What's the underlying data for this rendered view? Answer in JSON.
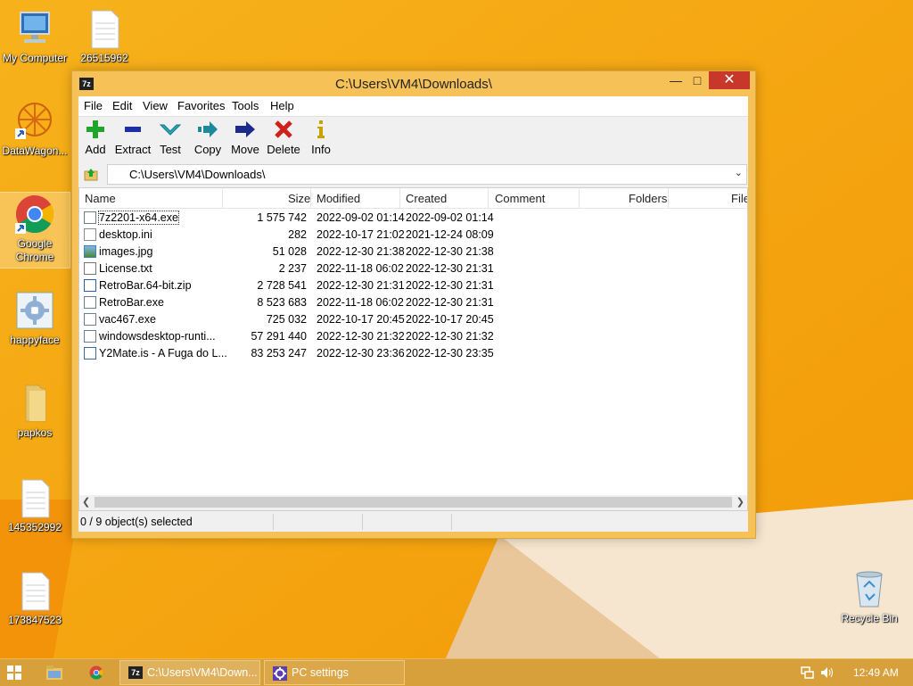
{
  "desktop": {
    "icons": [
      {
        "label": "My Computer"
      },
      {
        "label": "26515962"
      },
      {
        "label": "DataWagon..."
      },
      {
        "label": "Google Chrome"
      },
      {
        "label": "happyface"
      },
      {
        "label": "papkos"
      },
      {
        "label": "145352992"
      },
      {
        "label": "173847523"
      },
      {
        "label": "Recycle Bin"
      }
    ]
  },
  "window": {
    "title": "C:\\Users\\VM4\\Downloads\\",
    "app_icon_text": "7z",
    "menu": [
      "File",
      "Edit",
      "View",
      "Favorites",
      "Tools",
      "Help"
    ],
    "toolbar": [
      {
        "label": "Add",
        "icon": "plus-icon",
        "color": "#1fa52a"
      },
      {
        "label": "Extract",
        "icon": "minus-icon",
        "color": "#1c2fa5"
      },
      {
        "label": "Test",
        "icon": "check-icon",
        "color": "#2aa7b8"
      },
      {
        "label": "Copy",
        "icon": "copy-arrow-icon",
        "color": "#1c8a9c"
      },
      {
        "label": "Move",
        "icon": "move-arrow-icon",
        "color": "#1c2a8c"
      },
      {
        "label": "Delete",
        "icon": "x-icon",
        "color": "#d0201c"
      },
      {
        "label": "Info",
        "icon": "info-icon",
        "color": "#c9a200"
      }
    ],
    "address": "C:\\Users\\VM4\\Downloads\\",
    "columns": [
      "Name",
      "Size",
      "Modified",
      "Created",
      "Comment",
      "Folders",
      "File"
    ],
    "files": [
      {
        "name": "7z2201-x64.exe",
        "size": "1 575 742",
        "modified": "2022-09-02 01:14",
        "created": "2022-09-02 01:14",
        "type": "exe"
      },
      {
        "name": "desktop.ini",
        "size": "282",
        "modified": "2022-10-17 21:02",
        "created": "2021-12-24 08:09",
        "type": "ini"
      },
      {
        "name": "images.jpg",
        "size": "51 028",
        "modified": "2022-12-30 21:38",
        "created": "2022-12-30 21:38",
        "type": "jpg"
      },
      {
        "name": "License.txt",
        "size": "2 237",
        "modified": "2022-11-18 06:02",
        "created": "2022-12-30 21:31",
        "type": "txt"
      },
      {
        "name": "RetroBar.64-bit.zip",
        "size": "2 728 541",
        "modified": "2022-12-30 21:31",
        "created": "2022-12-30 21:31",
        "type": "zip"
      },
      {
        "name": "RetroBar.exe",
        "size": "8 523 683",
        "modified": "2022-11-18 06:02",
        "created": "2022-12-30 21:31",
        "type": "exe"
      },
      {
        "name": "vac467.exe",
        "size": "725 032",
        "modified": "2022-10-17 20:45",
        "created": "2022-10-17 20:45",
        "type": "exe"
      },
      {
        "name": "windowsdesktop-runti...",
        "size": "57 291 440",
        "modified": "2022-12-30 21:32",
        "created": "2022-12-30 21:32",
        "type": "exe"
      },
      {
        "name": "Y2Mate.is - A Fuga do L...",
        "size": "83 253 247",
        "modified": "2022-12-30 23:36",
        "created": "2022-12-30 23:35",
        "type": "media"
      }
    ],
    "status": "0 / 9 object(s) selected"
  },
  "taskbar": {
    "tasks": [
      {
        "label": "C:\\Users\\VM4\\Down...",
        "icon": "7zip-icon"
      },
      {
        "label": "PC settings",
        "icon": "gear-icon"
      }
    ],
    "clock": "12:49 AM"
  },
  "colors": {
    "desktop": "#f4a20c",
    "window_frame": "#f6c257",
    "close_button": "#c7382b",
    "taskbar": "#d8a03a"
  }
}
